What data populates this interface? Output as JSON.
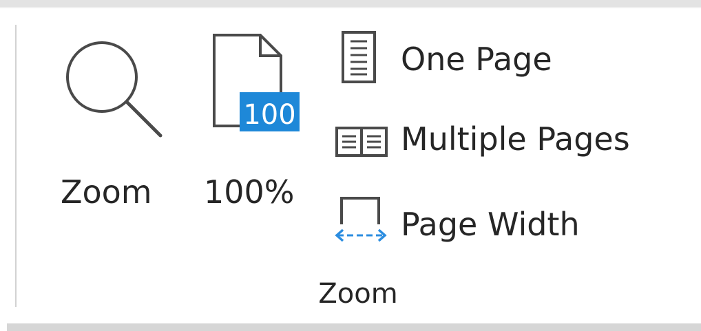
{
  "ribbon_group": {
    "caption": "Zoom",
    "zoom_button": {
      "label": "Zoom",
      "icon": "magnifier-icon"
    },
    "hundred_button": {
      "label": "100%",
      "icon": "page-100-icon",
      "badge": "100",
      "badge_color": "#1e88d8"
    },
    "one_page_button": {
      "label": "One Page",
      "icon": "one-page-icon"
    },
    "multiple_pages_button": {
      "label": "Multiple Pages",
      "icon": "multiple-pages-icon"
    },
    "page_width_button": {
      "label": "Page Width",
      "icon": "page-width-icon",
      "arrow_color": "#2b8de0"
    }
  }
}
